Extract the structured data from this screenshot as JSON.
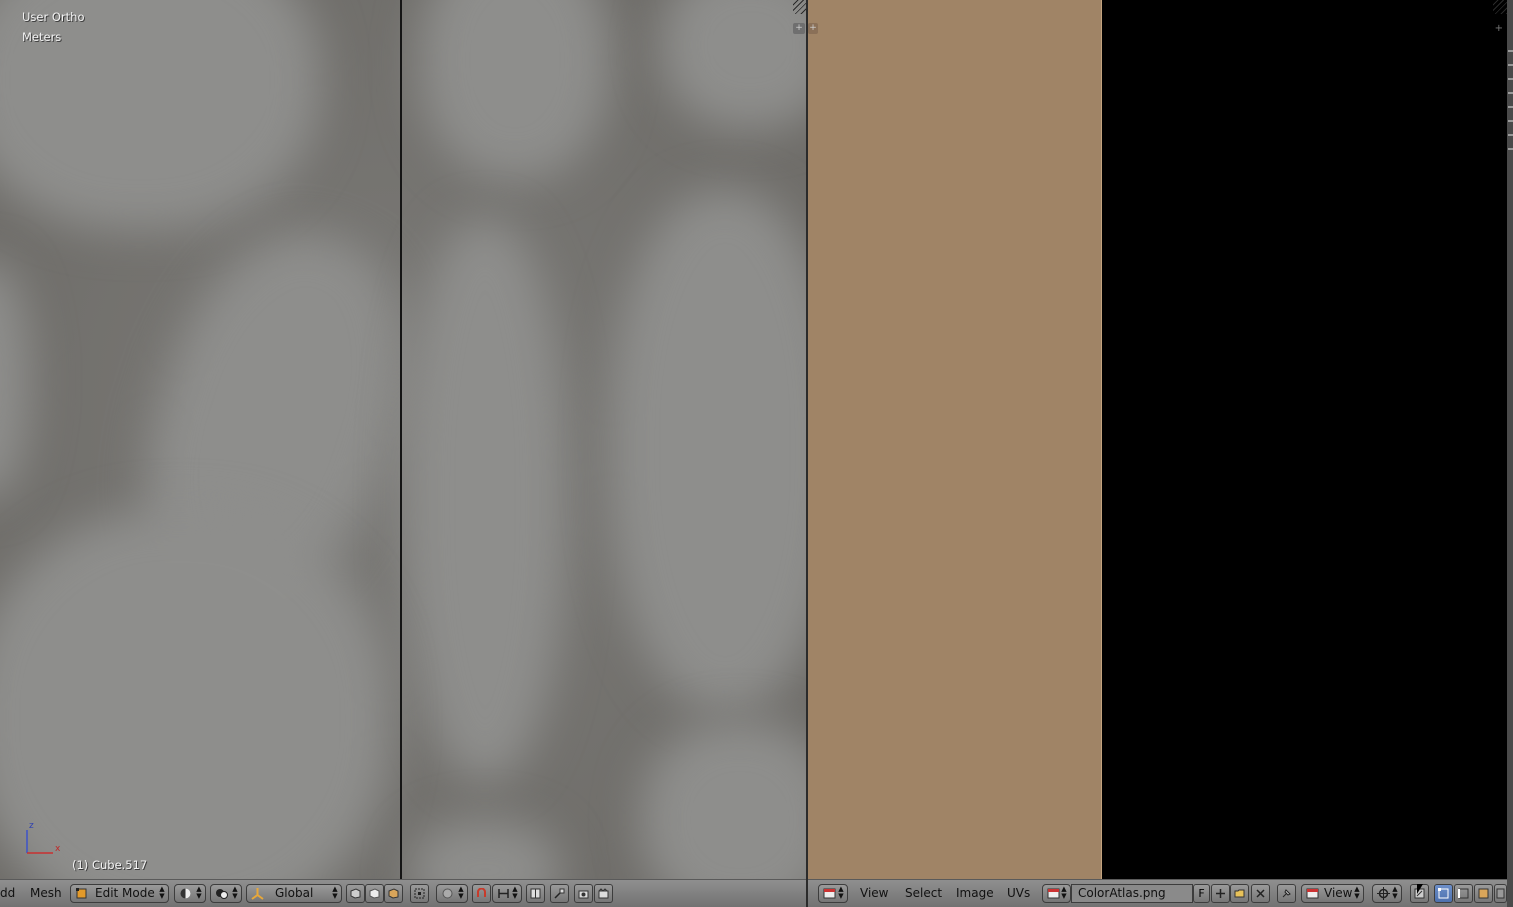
{
  "viewport": {
    "view_name": "User Ortho",
    "units": "Meters",
    "object_info": "(1) Cube.517",
    "axis_z": "z",
    "axis_x": "x"
  },
  "header_3d": {
    "menu_add": "dd",
    "menu_mesh": "Mesh",
    "mode": "Edit Mode",
    "orientation": "Global",
    "icons": [
      "viewport-shading-icon",
      "pivot-icon",
      "transform-manipulator-icon",
      "solid-face-icon",
      "wire-face-icon",
      "box-face-icon",
      "limit-selection-icon",
      "proportional-edit-icon",
      "snap-magnet-icon",
      "snap-element-icon",
      "mirror-icon",
      "render-icon",
      "render-anim-icon"
    ]
  },
  "header_uv": {
    "menu_view": "View",
    "menu_select": "Select",
    "menu_image": "Image",
    "menu_uvs": "UVs",
    "image_name": "ColorAtlas.png",
    "fake_user": "F",
    "view_mode": "View"
  },
  "colors": {
    "texture": "#a08466",
    "uv_background": "#000000",
    "header": "#808080",
    "accent_active": "#5578b8"
  }
}
